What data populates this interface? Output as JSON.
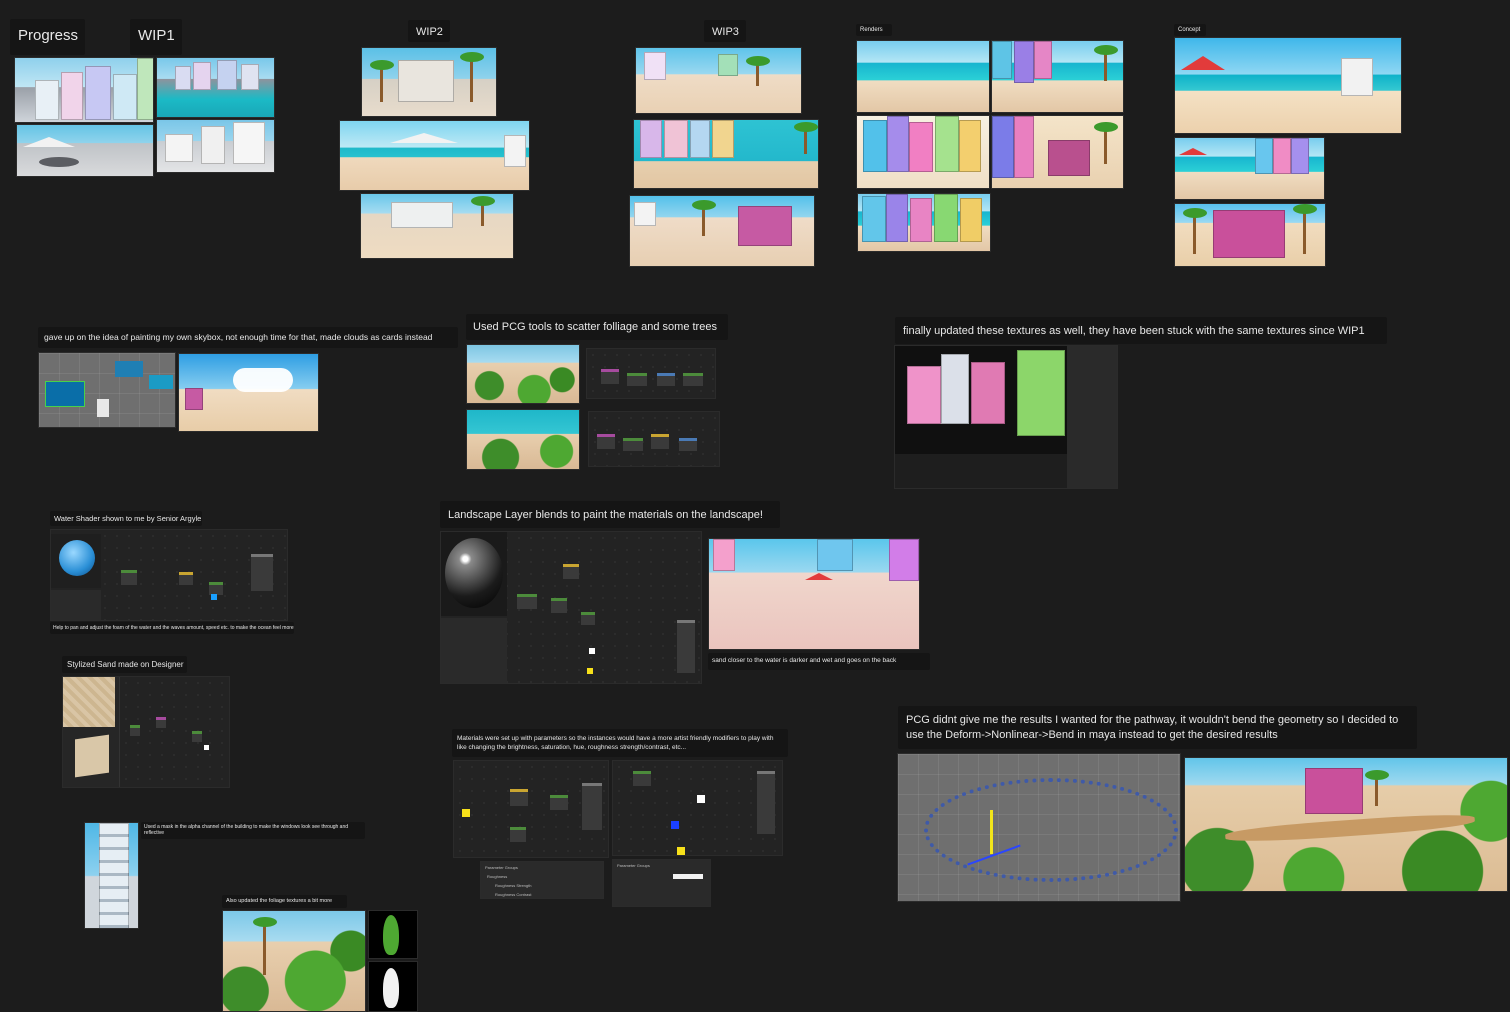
{
  "board": {
    "background": "#1c1c1c",
    "label_background": "#151515",
    "text_color": "#e8e8e8"
  },
  "sections": {
    "progress": "Progress",
    "wip1": "WIP1",
    "wip2": "WIP2",
    "wip3": "WIP3",
    "renders": "Renders",
    "concept": "Concept"
  },
  "notes": {
    "skybox": "gave up on the idea of painting my own skybox, not enough time for that, made clouds as cards instead",
    "pcg": "Used PCG tools to scatter folliage and some trees",
    "textures": "finally updated these textures as well, they have been stuck with the same textures since WIP1",
    "water_shader": "Water Shader shown to me by Senior Argyle",
    "water_caption": "Help to pan and adjust the foam of the water and the waves amount, speed etc. to make the ocean feel more alive",
    "landscape": "Landscape Layer blends to paint the materials on the landscape!",
    "landscape_caption": "sand closer to the water is darker and wet and goes on the back",
    "sand": "Stylized Sand made on Designer",
    "building_caption": "Used a mask in the alpha channel of the building to make the windows look see through and reflective",
    "foliage_caption": "Also updated the foliage textures a bit more",
    "materials": "Materials were set up with parameters so the instances would have a more artist friendly modifiers to play with like changing the brightness, saturation, hue, roughness strength/contrast, etc...",
    "pcg_path": "PCG didnt give me the results I wanted for the pathway, it wouldn't bend the geometry so I decided to use the Deform->Nonlinear->Bend in maya instead to get the desired results"
  },
  "material_panels": {
    "left_header": "Parameter Groups",
    "left_row1": "Roughness",
    "left_row2": "Roughness Strength",
    "left_row3": "Roughness Contrast",
    "right_header": "Parameter Groups"
  },
  "colors": {
    "sky": "#8fd4ee",
    "sea": "#1fb9c9",
    "sand": "#e8ccaa",
    "palm_leaf": "#3b9a2c",
    "node_header": "#4c8b3b"
  }
}
